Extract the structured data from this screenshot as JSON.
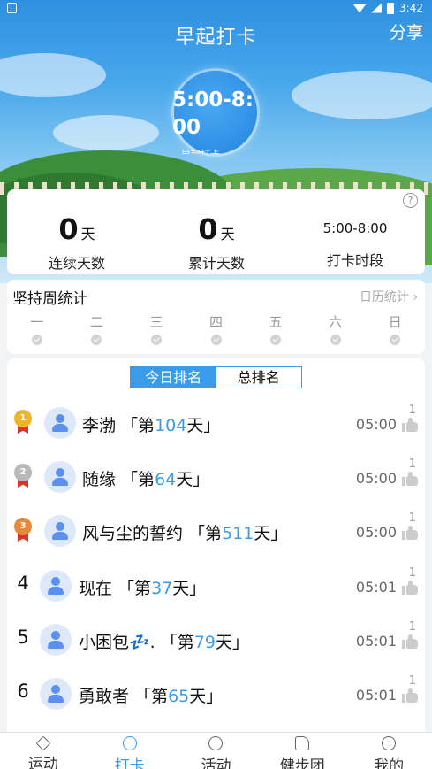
{
  "status_bar": {
    "time": "3:42"
  },
  "header": {
    "title": "早起打卡",
    "share_label": "分享"
  },
  "clock": {
    "time_range": "5:00-8:00",
    "subtitle": "早起打卡"
  },
  "stats": {
    "items": [
      {
        "value": "0",
        "unit": "天",
        "label": "连续天数"
      },
      {
        "value": "0",
        "unit": "天",
        "label": "累计天数"
      },
      {
        "value": "5:00-8:00",
        "unit": "",
        "label": "打卡时段"
      }
    ],
    "help_icon": "question-icon"
  },
  "weekly": {
    "title": "坚持周统计",
    "link_label": "日历统计 ›",
    "days": [
      "一",
      "二",
      "三",
      "四",
      "五",
      "六",
      "日"
    ]
  },
  "ranking": {
    "tabs": [
      {
        "label": "今日排名",
        "active": true
      },
      {
        "label": "总排名",
        "active": false
      }
    ],
    "rows": [
      {
        "rank": "1",
        "medal": "gold",
        "name": "李渤",
        "prefix": " 「第",
        "days": "104",
        "suffix": "天」",
        "time": "05:00",
        "likes": "1"
      },
      {
        "rank": "2",
        "medal": "silver",
        "name": "随缘",
        "prefix": " 「第",
        "days": "64",
        "suffix": "天」",
        "time": "05:00",
        "likes": "1"
      },
      {
        "rank": "3",
        "medal": "bronze",
        "name": "风与尘的誓约",
        "prefix": " 「第",
        "days": "511",
        "suffix": "天」",
        "time": "05:00",
        "likes": "1"
      },
      {
        "rank": "4",
        "medal": "",
        "name": "现在",
        "prefix": " 「第",
        "days": "37",
        "suffix": "天」",
        "time": "05:01",
        "likes": "1"
      },
      {
        "rank": "5",
        "medal": "",
        "name": "小困包💤.",
        "prefix": " 「第",
        "days": "79",
        "suffix": "天」",
        "time": "05:01",
        "likes": "1"
      },
      {
        "rank": "6",
        "medal": "",
        "name": "勇敢者",
        "prefix": " 「第",
        "days": "65",
        "suffix": "天」",
        "time": "05:01",
        "likes": "1"
      }
    ]
  },
  "bottom_nav": [
    {
      "label": "运动",
      "icon": "run-icon",
      "active": false
    },
    {
      "label": "打卡",
      "icon": "alarm-clock-icon",
      "active": true
    },
    {
      "label": "活动",
      "icon": "activity-icon",
      "active": false
    },
    {
      "label": "健步团",
      "icon": "shoe-icon",
      "active": false
    },
    {
      "label": "我的",
      "icon": "user-icon",
      "active": false
    }
  ],
  "colors": {
    "accent": "#3a9ce9",
    "gold": "#f0b429",
    "silver": "#b9b9b9",
    "bronze": "#e8893a"
  }
}
